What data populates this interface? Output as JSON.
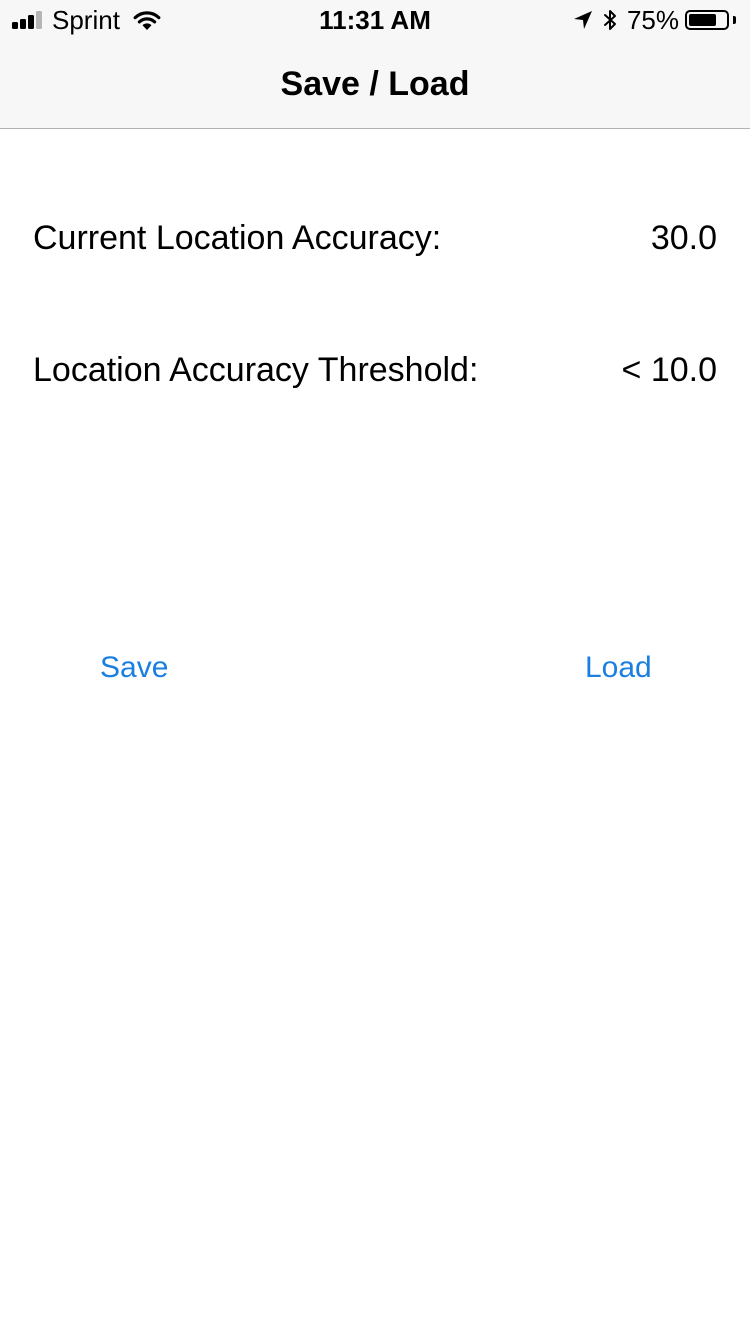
{
  "status_bar": {
    "carrier": "Sprint",
    "time": "11:31 AM",
    "battery_percent": "75%",
    "battery_level": 0.75,
    "signal_bars_filled": 3,
    "signal_bars_total": 4,
    "icons": [
      "signal-bars-icon",
      "wifi-icon",
      "location-arrow-icon",
      "bluetooth-icon",
      "battery-icon"
    ]
  },
  "nav": {
    "title": "Save / Load"
  },
  "rows": [
    {
      "label": "Current Location Accuracy:",
      "value": "30.0"
    },
    {
      "label": "Location Accuracy Threshold:",
      "value": "< 10.0"
    }
  ],
  "actions": {
    "save_label": "Save",
    "load_label": "Load"
  },
  "colors": {
    "accent": "#1a7fe0",
    "bar_background": "#f7f7f7",
    "divider": "#b2b2b2",
    "text": "#000000"
  }
}
